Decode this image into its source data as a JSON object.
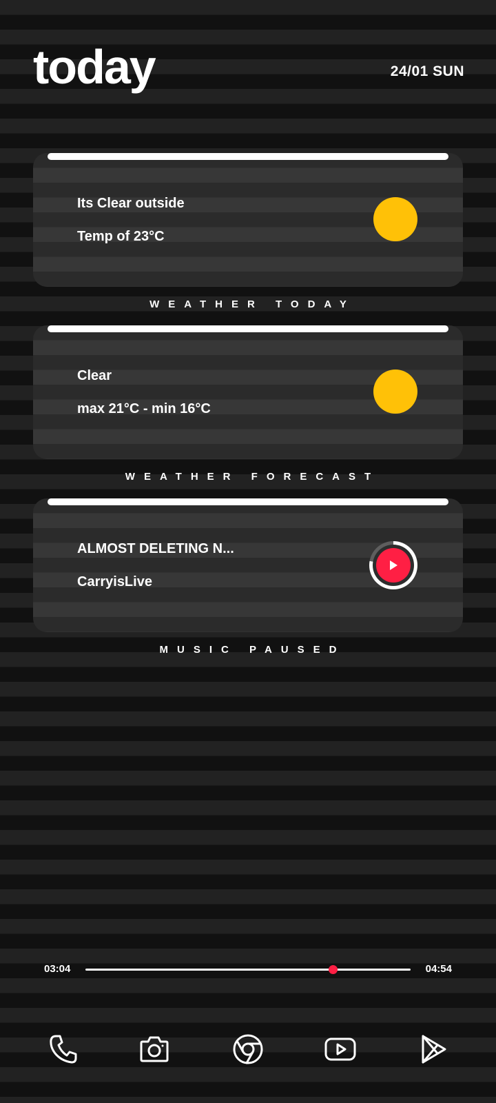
{
  "header": {
    "title": "today",
    "date": "24/01 SUN"
  },
  "cards": [
    {
      "line1": "Its Clear outside",
      "line2": "Temp of 23°C",
      "caption": "WEATHER TODAY",
      "icon": "sun-icon"
    },
    {
      "line1": "Clear",
      "line2": "max 21°C - min 16°C",
      "caption": "WEATHER FORECAST",
      "icon": "sun-icon"
    },
    {
      "line1": "ALMOST DELETING N...",
      "line2": "CarryisLive",
      "caption": "MUSIC PAUSED",
      "icon": "play-icon"
    }
  ],
  "player": {
    "current_time": "03:04",
    "total_time": "04:54",
    "progress": 0.76
  },
  "dock": [
    {
      "icon": "phone-icon"
    },
    {
      "icon": "camera-icon"
    },
    {
      "icon": "chrome-icon"
    },
    {
      "icon": "youtube-icon"
    },
    {
      "icon": "play-store-icon"
    }
  ],
  "colors": {
    "accent": "#ff1f44",
    "sun": "#ffc107",
    "background": "#111111",
    "stripe": "#222222"
  }
}
